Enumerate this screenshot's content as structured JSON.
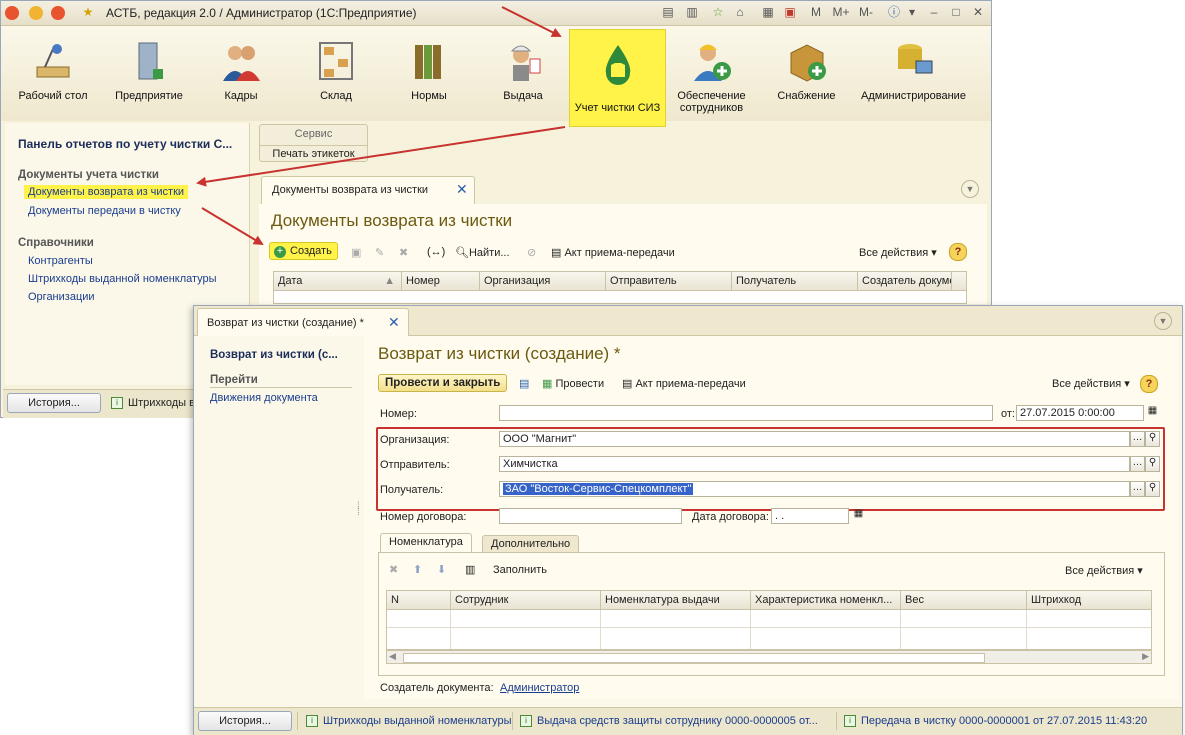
{
  "back_window": {
    "title": "АСТБ, редакция 2.0 / Администратор  (1С:Предприятие)",
    "title_buttons": [
      "M",
      "M+",
      "M-"
    ],
    "sections": [
      {
        "label": "Рабочий стол",
        "icon": "desk-lamp-icon"
      },
      {
        "label": "Предприятие",
        "icon": "building-icon"
      },
      {
        "label": "Кадры",
        "icon": "people-icon"
      },
      {
        "label": "Склад",
        "icon": "warehouse-shelf-icon"
      },
      {
        "label": "Нормы",
        "icon": "binders-icon"
      },
      {
        "label": "Выдача",
        "icon": "worker-helmet-icon"
      },
      {
        "label": "Учет чистки СИЗ",
        "icon": "shirt-drop-icon",
        "active": true
      },
      {
        "label": "Обеспечение сотрудников",
        "icon": "worker-add-icon"
      },
      {
        "label": "Снабжение",
        "icon": "box-add-icon"
      },
      {
        "label": "Администрирование",
        "icon": "database-pc-icon"
      }
    ],
    "left_panel": {
      "title": "Панель отчетов по учету чистки С...",
      "group1": "Документы учета чистки",
      "link1": "Документы возврата из чистки",
      "link2": "Документы передачи в чистку",
      "group2": "Справочники",
      "link3": "Контрагенты",
      "link4": "Штрихкоды выданной номенклатуры",
      "link5": "Организации"
    },
    "service": {
      "header": "Сервис",
      "item": "Печать этикеток"
    },
    "tab_label": "Документы возврата из чистки",
    "heading": "Документы возврата из чистки",
    "toolbar": {
      "create": "Создать",
      "find": "Найти...",
      "act": "Акт приема-передачи",
      "all_actions": "Все действия",
      "help": "?"
    },
    "columns": [
      "Дата",
      "Номер",
      "Организация",
      "Отправитель",
      "Получатель",
      "Создатель докуме"
    ],
    "status": {
      "history": "История...",
      "item": "Штрихкоды в"
    }
  },
  "front_window": {
    "tab_label": "Возврат из чистки (создание) *",
    "left": {
      "title": "Возврат из чистки (с...",
      "goto": "Перейти",
      "link": "Движения документа"
    },
    "heading": "Возврат из чистки (создание) *",
    "toolbar": {
      "post_close": "Провести и закрыть",
      "post": "Провести",
      "act": "Акт приема-передачи",
      "all_actions": "Все действия",
      "help": "?"
    },
    "fields": {
      "number_label": "Номер:",
      "number_value": "",
      "date_label": "от:",
      "date_value": "27.07.2015  0:00:00",
      "org_label": "Организация:",
      "org_value": "ООО \"Магнит\"",
      "sender_label": "Отправитель:",
      "sender_value": "Химчистка",
      "recipient_label": "Получатель:",
      "recipient_value": "ЗАО \"Восток-Сервис-Спецкомплект\"",
      "contract_num_label": "Номер договора:",
      "contract_num_value": "",
      "contract_date_label": "Дата договора:",
      "contract_date_value": " .  ."
    },
    "inner_tabs": [
      "Номенклатура",
      "Дополнительно"
    ],
    "inner_toolbar": {
      "fill": "Заполнить",
      "all_actions": "Все действия"
    },
    "table_columns": [
      "N",
      "Сотрудник",
      "Номенклатура выдачи",
      "Характеристика номенкл...",
      "Вес",
      "Штрихкод"
    ],
    "creator_label": "Создатель документа:",
    "creator_value": "Администратор",
    "status": {
      "history": "История...",
      "item1": "Штрихкоды выданной номенклатуры",
      "item2": "Выдача средств защиты сотруднику 0000-0000005 от...",
      "item3": "Передача в чистку 0000-0000001 от 27.07.2015 11:43:20"
    }
  },
  "colors": {
    "highlight": "#fff34a",
    "annotation_red": "#c8322f",
    "link_blue": "#1a3d8f",
    "heading_olive": "#6b5a10"
  }
}
